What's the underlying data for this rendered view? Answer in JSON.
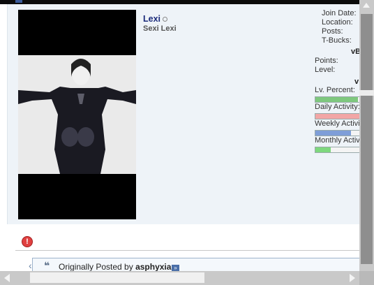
{
  "user": {
    "name": "Lexi",
    "title": "Sexi Lexi"
  },
  "stats": {
    "join_date_label": "Join Date:",
    "location_label": "Location:",
    "posts_label": "Posts:",
    "tbucks_label": "T-Bucks:",
    "vb_heading_1": "vB",
    "points_label": "Points:",
    "level_label": "Level:",
    "vb_heading_2": "v",
    "lv_percent_label": "Lv. Percent:",
    "daily_activity_label": "Daily Activity:",
    "weekly_activity_label": "Weekly Activit",
    "monthly_activity_label": "Monthly Activ"
  },
  "bars": {
    "lv_percent": {
      "fraction": 0.95,
      "color": "#7ec87e"
    },
    "daily_activity": {
      "fraction": 1.0,
      "color": "#f2a6a6"
    },
    "weekly_activity": {
      "fraction": 0.8,
      "color": "#7e9ed8"
    },
    "monthly_activity": {
      "fraction": 0.35,
      "color": "#7ed87e"
    }
  },
  "quote": {
    "prefix": "Originally Posted by",
    "author": "asphyxia"
  },
  "icons": {
    "report": "warning-icon",
    "quote": "quote-icon",
    "view_post": "arrow-link-icon"
  },
  "colors": {
    "post_background": "#eef3f8",
    "username": "#1a2a7a"
  }
}
